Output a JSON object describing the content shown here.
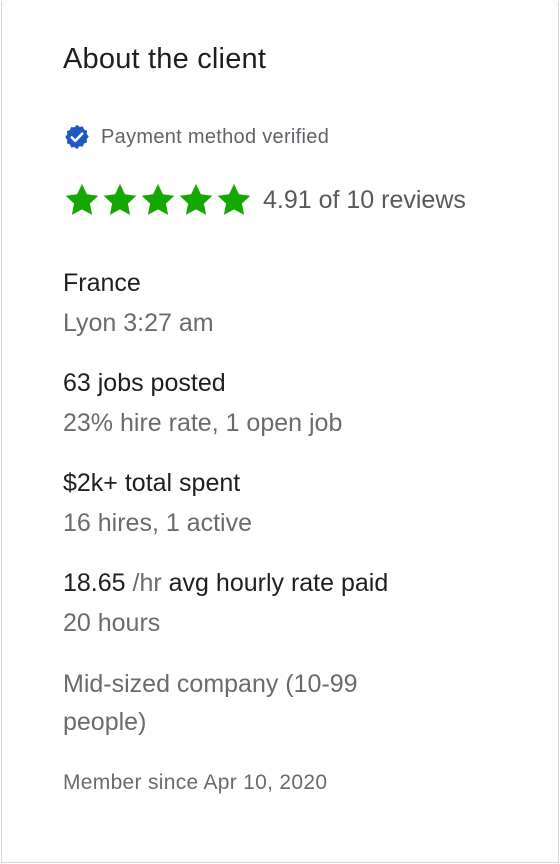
{
  "header": {
    "title": "About the client"
  },
  "payment": {
    "label": "Payment method verified"
  },
  "rating": {
    "stars": 5,
    "text": "4.91 of 10 reviews"
  },
  "location": {
    "country": "France",
    "city_time": "Lyon 3:27 am"
  },
  "jobs": {
    "posted": "63 jobs posted",
    "detail": "23% hire rate, 1 open job"
  },
  "spend": {
    "total": "$2k+ total spent",
    "detail": "16 hires, 1 active"
  },
  "hourly": {
    "rate": "18.65",
    "unit": "/hr",
    "label": "avg hourly rate paid",
    "hours": "20 hours"
  },
  "company": {
    "size": "Mid-sized company (10-99 people)"
  },
  "member": {
    "since": "Member since Apr 10, 2020"
  },
  "colors": {
    "star": "#14a800",
    "verified": "#1f57c3"
  },
  "icons": {
    "verified": "verified-badge-icon",
    "star": "star-icon"
  }
}
